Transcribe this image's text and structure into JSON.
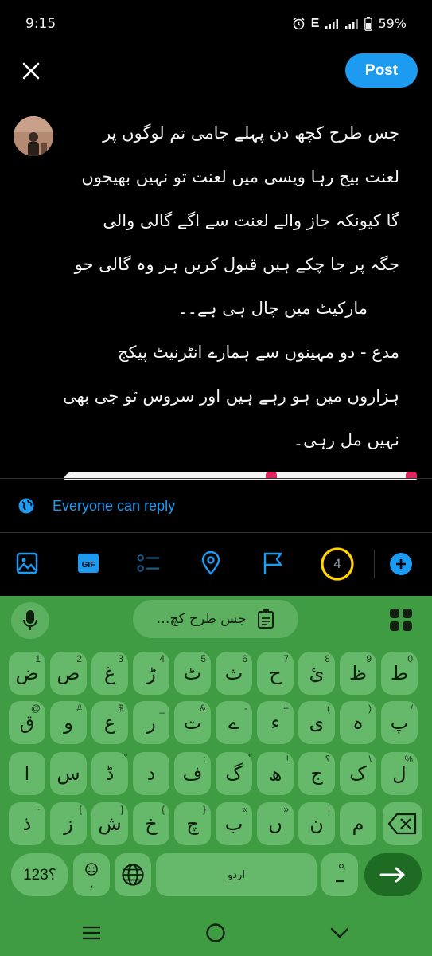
{
  "status_bar": {
    "time": "9:15",
    "network": "E",
    "battery": "59%",
    "icons": [
      "alarm-icon",
      "signal-icon",
      "signal-icon",
      "battery-icon"
    ]
  },
  "header": {
    "close_icon": "close-icon",
    "post_label": "Post"
  },
  "compose": {
    "lines": [
      "جس طرح کچھ دن پہلے جامی تم لوگوں پر",
      "لعنت بیج رہا ویسی میں لعنت تو نہیں بھیجوں",
      "گا کیونکہ جاز والے لعنت سے اگے گالی والی",
      "جگہ پر جا چکے ہیں قبول کریں ہر وہ گالی جو",
      "مارکیٹ میں چال ہی ہے۔۔",
      "مدع - دو مہینوں سے ہمارے انٹرنیٹ پیکج",
      "ہزاروں میں ہو رہے ہیں اور سروس ٹو جی بھی",
      "نہیں مل رہی۔"
    ]
  },
  "reply_setting": {
    "label": "Everyone can reply",
    "icon": "globe-icon"
  },
  "toolbar": {
    "tools": [
      "image-icon",
      "gif-icon",
      "poll-icon",
      "location-icon",
      "flag-icon"
    ],
    "gif_label": "GIF",
    "char_counter": "4",
    "colors": {
      "accent": "#1d9bf0",
      "counter_ring": "#ffd400"
    }
  },
  "keyboard": {
    "suggestion": "جس طرح کچ…",
    "row1": [
      {
        "key": "ض",
        "hint": "1"
      },
      {
        "key": "ص",
        "hint": "2"
      },
      {
        "key": "غ",
        "hint": "3"
      },
      {
        "key": "ڑ",
        "hint": "4"
      },
      {
        "key": "ٹ",
        "hint": "5"
      },
      {
        "key": "ث",
        "hint": "6"
      },
      {
        "key": "ح",
        "hint": "7"
      },
      {
        "key": "ئ",
        "hint": "8"
      },
      {
        "key": "ظ",
        "hint": "9"
      },
      {
        "key": "ط",
        "hint": "0"
      }
    ],
    "row2": [
      {
        "key": "ق",
        "hint": "@"
      },
      {
        "key": "و",
        "hint": "#"
      },
      {
        "key": "ع",
        "hint": "$"
      },
      {
        "key": "ر",
        "hint": "_"
      },
      {
        "key": "ت",
        "hint": "&"
      },
      {
        "key": "ے",
        "hint": "-"
      },
      {
        "key": "ء",
        "hint": "+"
      },
      {
        "key": "ی",
        "hint": "("
      },
      {
        "key": "ہ",
        "hint": ")"
      },
      {
        "key": "پ",
        "hint": "/"
      }
    ],
    "row3": [
      {
        "key": "ا",
        "hint": ""
      },
      {
        "key": "س",
        "hint": ""
      },
      {
        "key": "ڈ",
        "hint": "ْ"
      },
      {
        "key": "د",
        "hint": ""
      },
      {
        "key": "ف",
        "hint": ":"
      },
      {
        "key": "گ",
        "hint": "ٗ"
      },
      {
        "key": "ھ",
        "hint": "!"
      },
      {
        "key": "ج",
        "hint": "؟"
      },
      {
        "key": "ک",
        "hint": "\\"
      },
      {
        "key": "ل",
        "hint": "%"
      }
    ],
    "row4": [
      {
        "key": "ذ",
        "hint": "~"
      },
      {
        "key": "ز",
        "hint": "["
      },
      {
        "key": "ش",
        "hint": "]"
      },
      {
        "key": "خ",
        "hint": "{"
      },
      {
        "key": "چ",
        "hint": "}"
      },
      {
        "key": "ب",
        "hint": "«"
      },
      {
        "key": "ں",
        "hint": "»"
      },
      {
        "key": "ن",
        "hint": "|"
      },
      {
        "key": "م",
        "hint": ""
      }
    ],
    "symbols_label": "؟123",
    "space_label": "اردو",
    "colors": {
      "background": "#3f9c43",
      "key": "#66b86a",
      "enter": "#1e6b23"
    }
  },
  "nav_bar": {
    "icons": [
      "recents-icon",
      "home-icon",
      "back-icon"
    ]
  }
}
